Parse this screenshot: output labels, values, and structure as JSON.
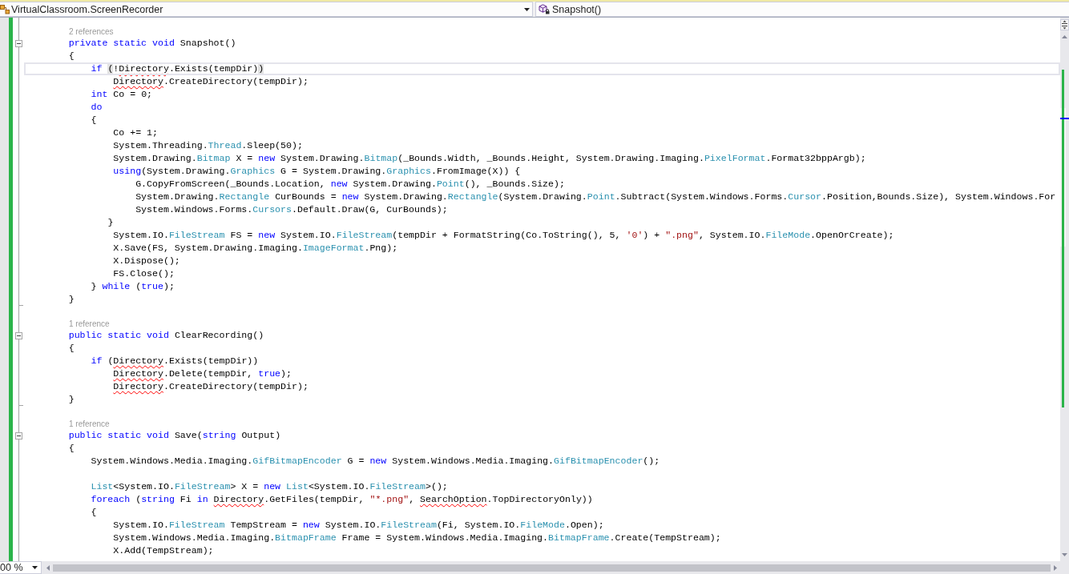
{
  "navigation_bar": {
    "type_dropdown": {
      "value": "VirtualClassroom.ScreenRecorder"
    },
    "member_dropdown": {
      "value": "Snapshot()"
    }
  },
  "editor": {
    "items": [
      {
        "kind": "member",
        "codelens": "2 references",
        "expanded": true,
        "end_visible": true,
        "lines": [
          {
            "kind": "code",
            "current": false,
            "tokens": [
              {
                "text": "        private static void",
                "kind": "keyword"
              },
              {
                "text": " Snapshot()",
                "kind": "plain"
              }
            ]
          },
          {
            "kind": "code",
            "current": false,
            "tokens": [
              {
                "text": "        {",
                "kind": "plain"
              }
            ]
          },
          {
            "kind": "code",
            "current": true,
            "tokens": [
              {
                "text": "            if ",
                "kind": "keyword"
              },
              {
                "text": "(",
                "kind": "brace_match"
              },
              {
                "text": "!",
                "kind": "plain"
              },
              {
                "text": "Directory",
                "kind": "error"
              },
              {
                "text": ".Exists(tempDir)",
                "kind": "plain"
              },
              {
                "text": ")",
                "kind": "brace_match"
              }
            ]
          },
          {
            "kind": "code",
            "current": false,
            "tokens": [
              {
                "text": "                Directory",
                "kind": "error"
              },
              {
                "text": ".CreateDirectory(tempDir);",
                "kind": "plain"
              }
            ]
          },
          {
            "kind": "code",
            "current": false,
            "tokens": [
              {
                "text": "            int",
                "kind": "keyword"
              },
              {
                "text": " Co = 0;",
                "kind": "plain"
              }
            ]
          },
          {
            "kind": "code",
            "current": false,
            "tokens": [
              {
                "text": "            do",
                "kind": "keyword"
              }
            ]
          },
          {
            "kind": "code",
            "current": false,
            "tokens": [
              {
                "text": "            {",
                "kind": "plain"
              }
            ]
          },
          {
            "kind": "code",
            "current": false,
            "tokens": [
              {
                "text": "                Co += 1;",
                "kind": "plain"
              }
            ]
          },
          {
            "kind": "code",
            "current": false,
            "tokens": [
              {
                "text": "                System.Threading.",
                "kind": "plain"
              },
              {
                "text": "Thread",
                "kind": "type"
              },
              {
                "text": ".Sleep(50);",
                "kind": "plain"
              }
            ]
          },
          {
            "kind": "code",
            "current": false,
            "tokens": [
              {
                "text": "                System.Drawing.",
                "kind": "plain"
              },
              {
                "text": "Bitmap",
                "kind": "type"
              },
              {
                "text": " X = ",
                "kind": "plain"
              },
              {
                "text": "new",
                "kind": "keyword"
              },
              {
                "text": " System.Drawing.",
                "kind": "plain"
              },
              {
                "text": "Bitmap",
                "kind": "type"
              },
              {
                "text": "(_Bounds.Width, _Bounds.Height, System.Drawing.Imaging.",
                "kind": "plain"
              },
              {
                "text": "PixelFormat",
                "kind": "type"
              },
              {
                "text": ".Format32bppArgb);",
                "kind": "plain"
              }
            ]
          },
          {
            "kind": "code",
            "current": false,
            "tokens": [
              {
                "text": "                using",
                "kind": "keyword"
              },
              {
                "text": "(System.Drawing.",
                "kind": "plain"
              },
              {
                "text": "Graphics",
                "kind": "type"
              },
              {
                "text": " G = System.Drawing.",
                "kind": "plain"
              },
              {
                "text": "Graphics",
                "kind": "type"
              },
              {
                "text": ".FromImage(X)) {",
                "kind": "plain"
              }
            ]
          },
          {
            "kind": "code",
            "current": false,
            "tokens": [
              {
                "text": "                    G.CopyFromScreen(_Bounds.Location, ",
                "kind": "plain"
              },
              {
                "text": "new",
                "kind": "keyword"
              },
              {
                "text": " System.Drawing.",
                "kind": "plain"
              },
              {
                "text": "Point",
                "kind": "type"
              },
              {
                "text": "(), _Bounds.Size);",
                "kind": "plain"
              }
            ]
          },
          {
            "kind": "code",
            "current": false,
            "tokens": [
              {
                "text": "                    System.Drawing.",
                "kind": "plain"
              },
              {
                "text": "Rectangle",
                "kind": "type"
              },
              {
                "text": " CurBounds = ",
                "kind": "plain"
              },
              {
                "text": "new",
                "kind": "keyword"
              },
              {
                "text": " System.Drawing.",
                "kind": "plain"
              },
              {
                "text": "Rectangle",
                "kind": "type"
              },
              {
                "text": "(System.Drawing.",
                "kind": "plain"
              },
              {
                "text": "Point",
                "kind": "type"
              },
              {
                "text": ".Subtract(System.Windows.Forms.",
                "kind": "plain"
              },
              {
                "text": "Cursor",
                "kind": "type"
              },
              {
                "text": ".Position,Bounds.Size), System.Windows.For",
                "kind": "plain"
              }
            ]
          },
          {
            "kind": "code",
            "current": false,
            "tokens": [
              {
                "text": "                    System.Windows.Forms.",
                "kind": "plain"
              },
              {
                "text": "Cursors",
                "kind": "type"
              },
              {
                "text": ".Default.Draw(G, CurBounds);",
                "kind": "plain"
              }
            ]
          },
          {
            "kind": "code",
            "current": false,
            "tokens": [
              {
                "text": "               }",
                "kind": "plain"
              }
            ]
          },
          {
            "kind": "code",
            "current": false,
            "tokens": [
              {
                "text": "                System.IO.",
                "kind": "plain"
              },
              {
                "text": "FileStream",
                "kind": "type"
              },
              {
                "text": " FS = ",
                "kind": "plain"
              },
              {
                "text": "new",
                "kind": "keyword"
              },
              {
                "text": " System.IO.",
                "kind": "plain"
              },
              {
                "text": "FileStream",
                "kind": "type"
              },
              {
                "text": "(tempDir + FormatString(Co.ToString(), 5, ",
                "kind": "plain"
              },
              {
                "text": "'0'",
                "kind": "string"
              },
              {
                "text": ") + ",
                "kind": "plain"
              },
              {
                "text": "\".png\"",
                "kind": "string"
              },
              {
                "text": ", System.IO.",
                "kind": "plain"
              },
              {
                "text": "FileMode",
                "kind": "type"
              },
              {
                "text": ".OpenOrCreate);",
                "kind": "plain"
              }
            ]
          },
          {
            "kind": "code",
            "current": false,
            "tokens": [
              {
                "text": "                X.Save(FS, System.Drawing.Imaging.",
                "kind": "plain"
              },
              {
                "text": "ImageFormat",
                "kind": "type"
              },
              {
                "text": ".Png);",
                "kind": "plain"
              }
            ]
          },
          {
            "kind": "code",
            "current": false,
            "tokens": [
              {
                "text": "                X.Dispose();",
                "kind": "plain"
              }
            ]
          },
          {
            "kind": "code",
            "current": false,
            "tokens": [
              {
                "text": "                FS.Close();",
                "kind": "plain"
              }
            ]
          },
          {
            "kind": "code",
            "current": false,
            "tokens": [
              {
                "text": "            } ",
                "kind": "plain"
              },
              {
                "text": "while",
                "kind": "keyword"
              },
              {
                "text": " (",
                "kind": "plain"
              },
              {
                "text": "true",
                "kind": "keyword"
              },
              {
                "text": ");",
                "kind": "plain"
              }
            ]
          },
          {
            "kind": "code",
            "current": false,
            "tokens": [
              {
                "text": "        }",
                "kind": "plain"
              }
            ]
          }
        ]
      },
      {
        "kind": "blank",
        "current": false
      },
      {
        "kind": "member",
        "codelens": "1 reference",
        "expanded": true,
        "end_visible": true,
        "lines": [
          {
            "kind": "code",
            "current": false,
            "tokens": [
              {
                "text": "        public static void",
                "kind": "keyword"
              },
              {
                "text": " ClearRecording()",
                "kind": "plain"
              }
            ]
          },
          {
            "kind": "code",
            "current": false,
            "tokens": [
              {
                "text": "        {",
                "kind": "plain"
              }
            ]
          },
          {
            "kind": "code",
            "current": false,
            "tokens": [
              {
                "text": "            if",
                "kind": "keyword"
              },
              {
                "text": " (",
                "kind": "plain"
              },
              {
                "text": "Directory",
                "kind": "error"
              },
              {
                "text": ".Exists(tempDir))",
                "kind": "plain"
              }
            ]
          },
          {
            "kind": "code",
            "current": false,
            "tokens": [
              {
                "text": "                Directory",
                "kind": "error"
              },
              {
                "text": ".Delete(tempDir, ",
                "kind": "plain"
              },
              {
                "text": "true",
                "kind": "keyword"
              },
              {
                "text": ");",
                "kind": "plain"
              }
            ]
          },
          {
            "kind": "code",
            "current": false,
            "tokens": [
              {
                "text": "                Directory",
                "kind": "error"
              },
              {
                "text": ".CreateDirectory(tempDir);",
                "kind": "plain"
              }
            ]
          },
          {
            "kind": "code",
            "current": false,
            "tokens": [
              {
                "text": "        }",
                "kind": "plain"
              }
            ]
          }
        ]
      },
      {
        "kind": "blank",
        "current": false
      },
      {
        "kind": "member",
        "codelens": "1 reference",
        "expanded": true,
        "end_visible": false,
        "lines": [
          {
            "kind": "code",
            "current": false,
            "tokens": [
              {
                "text": "        public static void",
                "kind": "keyword"
              },
              {
                "text": " Save(",
                "kind": "plain"
              },
              {
                "text": "string",
                "kind": "keyword"
              },
              {
                "text": " Output)",
                "kind": "plain"
              }
            ]
          },
          {
            "kind": "code",
            "current": false,
            "tokens": [
              {
                "text": "        {",
                "kind": "plain"
              }
            ]
          },
          {
            "kind": "code",
            "current": false,
            "tokens": [
              {
                "text": "            System.Windows.Media.Imaging.",
                "kind": "plain"
              },
              {
                "text": "GifBitmapEncoder",
                "kind": "type"
              },
              {
                "text": " G = ",
                "kind": "plain"
              },
              {
                "text": "new",
                "kind": "keyword"
              },
              {
                "text": " System.Windows.Media.Imaging.",
                "kind": "plain"
              },
              {
                "text": "GifBitmapEncoder",
                "kind": "type"
              },
              {
                "text": "();",
                "kind": "plain"
              }
            ]
          },
          {
            "kind": "blank",
            "current": false
          },
          {
            "kind": "code",
            "current": false,
            "tokens": [
              {
                "text": "            List",
                "kind": "type"
              },
              {
                "text": "<System.IO.",
                "kind": "plain"
              },
              {
                "text": "FileStream",
                "kind": "type"
              },
              {
                "text": "> X = ",
                "kind": "plain"
              },
              {
                "text": "new ",
                "kind": "keyword"
              },
              {
                "text": "List",
                "kind": "type"
              },
              {
                "text": "<System.IO.",
                "kind": "plain"
              },
              {
                "text": "FileStream",
                "kind": "type"
              },
              {
                "text": ">();",
                "kind": "plain"
              }
            ]
          },
          {
            "kind": "code",
            "current": false,
            "tokens": [
              {
                "text": "            foreach",
                "kind": "keyword"
              },
              {
                "text": " (",
                "kind": "plain"
              },
              {
                "text": "string",
                "kind": "keyword"
              },
              {
                "text": " Fi ",
                "kind": "plain"
              },
              {
                "text": "in ",
                "kind": "keyword"
              },
              {
                "text": "Directory",
                "kind": "error"
              },
              {
                "text": ".GetFiles(tempDir, ",
                "kind": "plain"
              },
              {
                "text": "\"*.png\"",
                "kind": "string"
              },
              {
                "text": ", ",
                "kind": "plain"
              },
              {
                "text": "SearchOption",
                "kind": "error"
              },
              {
                "text": ".TopDirectoryOnly))",
                "kind": "plain"
              }
            ]
          },
          {
            "kind": "code",
            "current": false,
            "tokens": [
              {
                "text": "            {",
                "kind": "plain"
              }
            ]
          },
          {
            "kind": "code",
            "current": false,
            "tokens": [
              {
                "text": "                System.IO.",
                "kind": "plain"
              },
              {
                "text": "FileStream",
                "kind": "type"
              },
              {
                "text": " TempStream = ",
                "kind": "plain"
              },
              {
                "text": "new",
                "kind": "keyword"
              },
              {
                "text": " System.IO.",
                "kind": "plain"
              },
              {
                "text": "FileStream",
                "kind": "type"
              },
              {
                "text": "(Fi, System.IO.",
                "kind": "plain"
              },
              {
                "text": "FileMode",
                "kind": "type"
              },
              {
                "text": ".Open);",
                "kind": "plain"
              }
            ]
          },
          {
            "kind": "code",
            "current": false,
            "tokens": [
              {
                "text": "                System.Windows.Media.Imaging.",
                "kind": "plain"
              },
              {
                "text": "BitmapFrame",
                "kind": "type"
              },
              {
                "text": " Frame = System.Windows.Media.Imaging.",
                "kind": "plain"
              },
              {
                "text": "BitmapFrame",
                "kind": "type"
              },
              {
                "text": ".Create(TempStream);",
                "kind": "plain"
              }
            ]
          },
          {
            "kind": "code",
            "current": false,
            "tokens": [
              {
                "text": "                X.Add(TempStream);",
                "kind": "plain"
              }
            ]
          }
        ]
      }
    ]
  },
  "zoom_dropdown": {
    "value": "00 %"
  }
}
